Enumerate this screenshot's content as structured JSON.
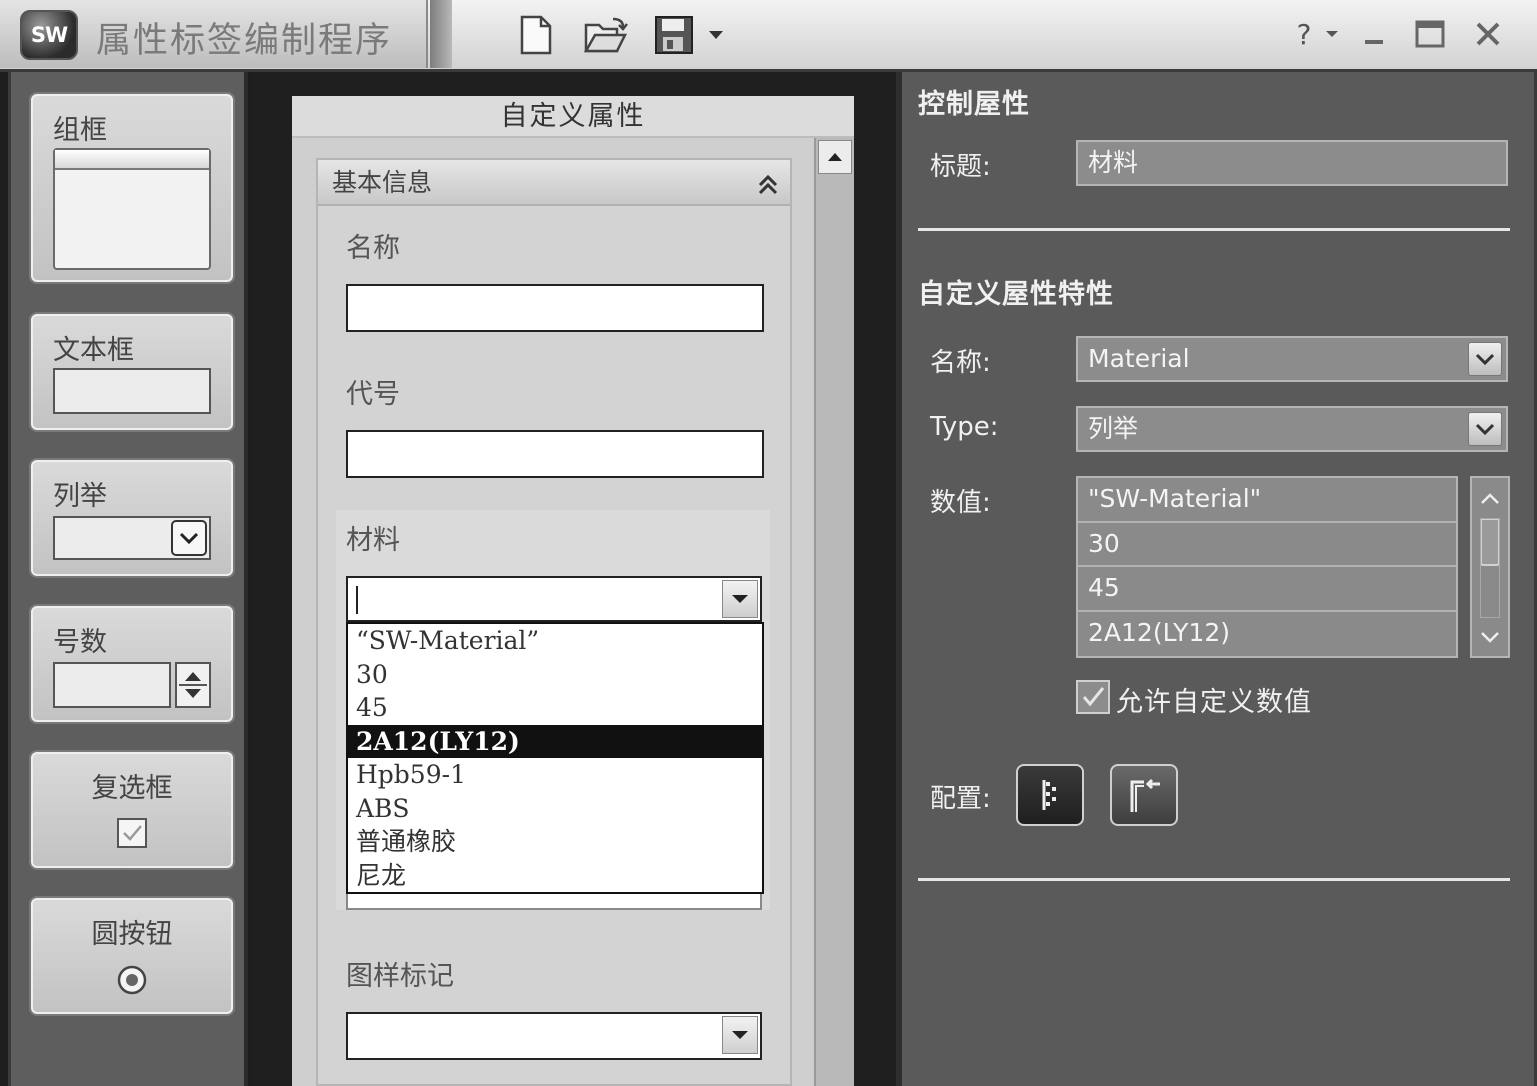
{
  "window": {
    "logo_text": "SW",
    "title": "属性标签编制程序",
    "help_label": "?",
    "toolbar": {
      "new_icon": "new-document-icon",
      "open_icon": "open-folder-icon",
      "save_icon": "save-disk-icon"
    }
  },
  "toolbox": {
    "items": [
      {
        "label": "组框"
      },
      {
        "label": "文本框"
      },
      {
        "label": "列举"
      },
      {
        "label": "号数"
      },
      {
        "label": "复选框"
      },
      {
        "label": "圆按钮"
      }
    ]
  },
  "preview": {
    "title": "自定义属性",
    "group_header": "基本信息",
    "fields": {
      "name_label": "名称",
      "code_label": "代号",
      "material_label": "材料",
      "drawing_mark_label": "图样标记"
    },
    "material_dropdown": {
      "options": [
        "“SW-Material”",
        "30",
        "45",
        "2A12(LY12)",
        "Hpb59-1",
        "ABS",
        "普通橡胶",
        "尼龙"
      ],
      "selected_index": 3
    }
  },
  "properties": {
    "control_section_title": "控制屋性",
    "caption_label": "标题:",
    "caption_value": "材料",
    "custom_section_title": "自定义屋性特性",
    "name_label": "名称:",
    "name_value": "Material",
    "type_label": "Type:",
    "type_value": "列举",
    "values_label": "数值:",
    "values": [
      "\"SW-Material\"",
      "30",
      "45",
      "2A12(LY12)"
    ],
    "allow_custom_label": "允许自定义数值",
    "allow_custom_checked": true,
    "config_label": "配置:"
  }
}
